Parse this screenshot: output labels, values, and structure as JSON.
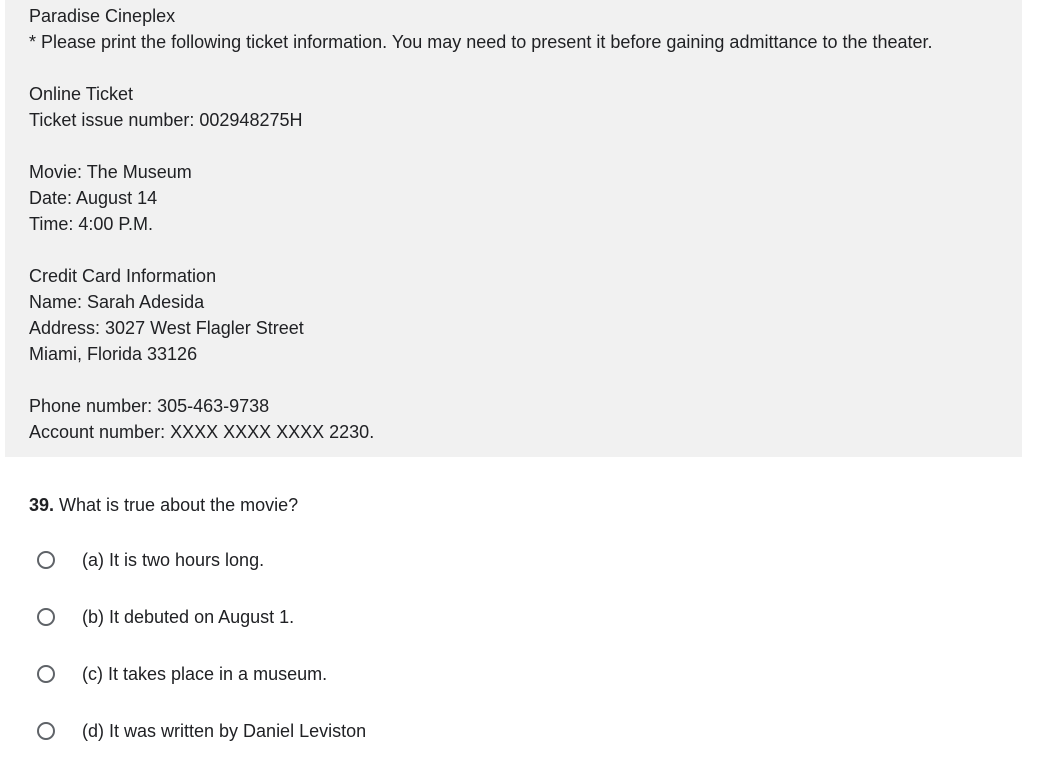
{
  "passage": {
    "lines": [
      "Paradise Cineplex",
      "* Please print the following ticket information. You may need to present it before gaining admittance to the theater.",
      "",
      "Online Ticket",
      "Ticket issue number: 002948275H",
      "",
      "Movie: The Museum",
      "Date: August 14",
      "Time: 4:00 P.M.",
      "",
      "Credit Card Information",
      "Name: Sarah Adesida",
      "Address: 3027 West Flagler Street",
      "Miami, Florida 33126",
      "",
      "Phone number: 305-463-9738",
      "Account number: XXXX XXXX XXXX 2230."
    ]
  },
  "question": {
    "number": "39.",
    "text": " What is true about the movie?",
    "options": [
      "(a) It is two hours long.",
      "(b) It debuted on August 1.",
      "(c) It takes place in a museum.",
      "(d) It was written by Daniel Leviston"
    ]
  },
  "colors": {
    "passage_background": "#f1f1f1",
    "text": "#202124",
    "radio_border": "#5f6368"
  }
}
